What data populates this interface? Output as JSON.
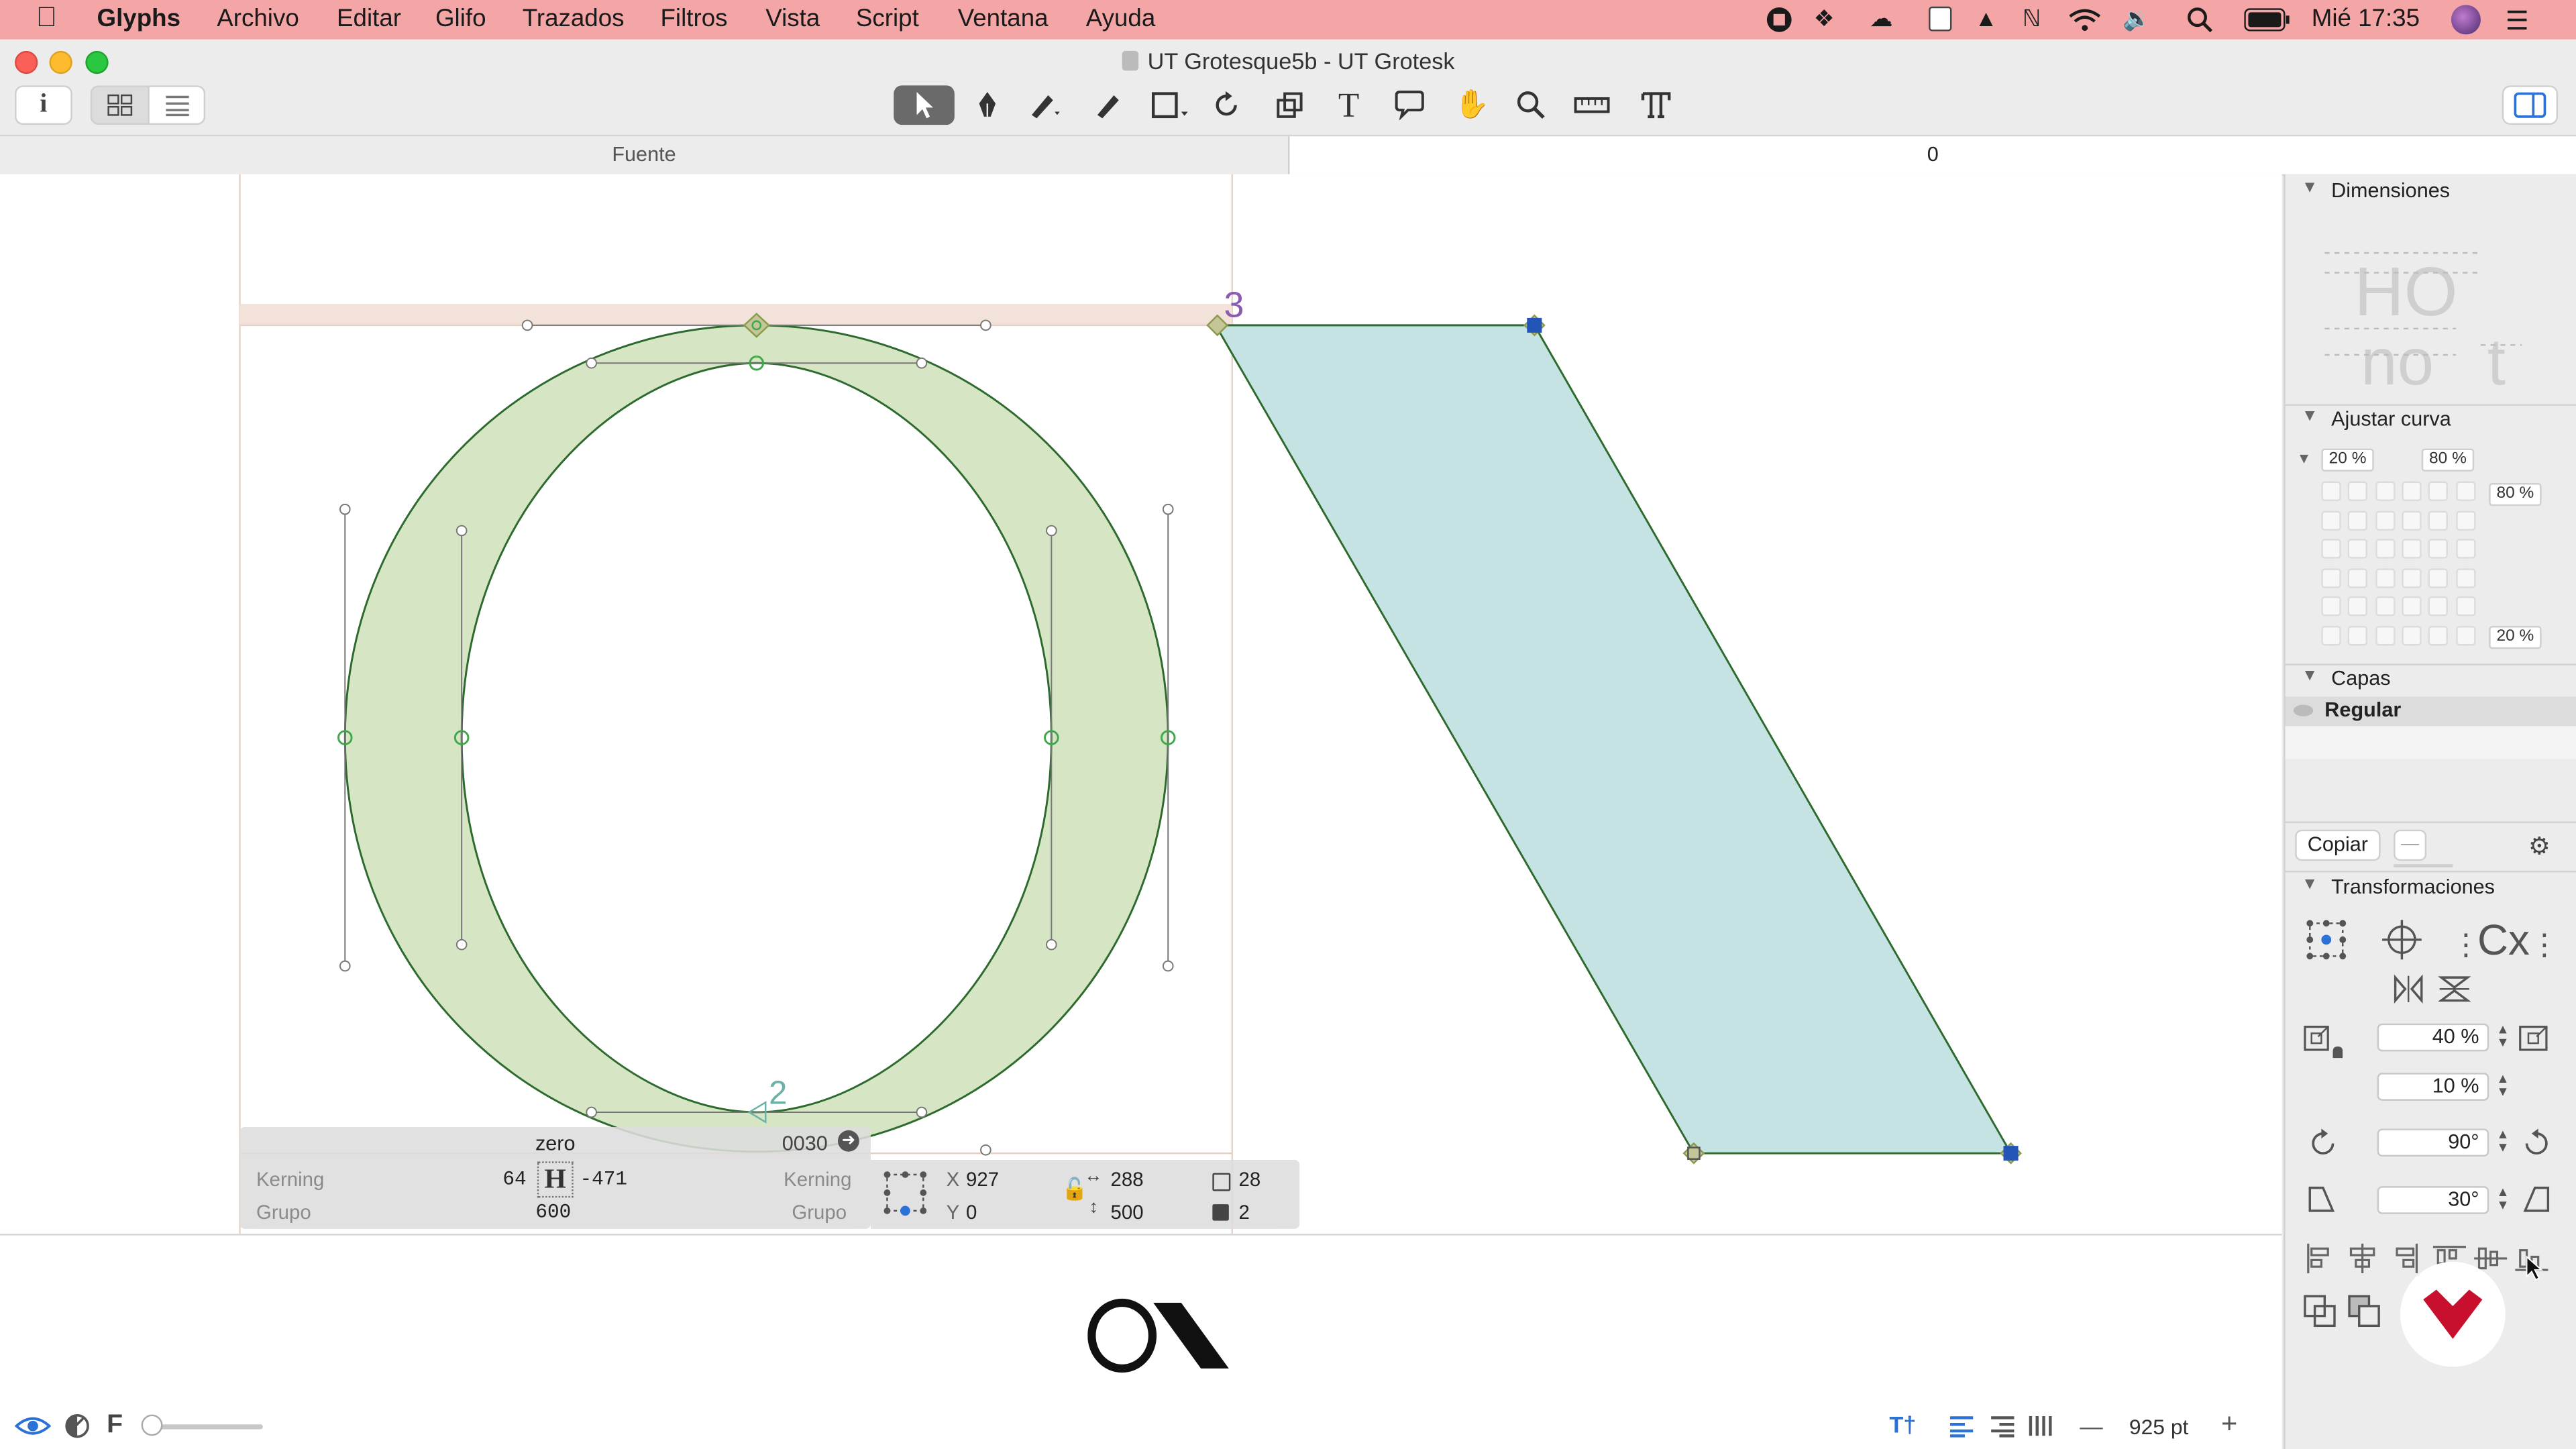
{
  "menubar": {
    "app": "Glyphs",
    "items": [
      "Archivo",
      "Editar",
      "Glifo",
      "Trazados",
      "Filtros",
      "Vista",
      "Script",
      "Ventana",
      "Ayuda"
    ],
    "clock": "Mié 17:35",
    "bg": "#f4a5a6"
  },
  "window": {
    "title": "UT Grotesque5b - UT Grotesk"
  },
  "tabs": {
    "left": "Fuente",
    "right": "0"
  },
  "info": {
    "glyph_name": "zero",
    "unicode": "0030",
    "kerning_label": "Kerning",
    "group_label": "Grupo",
    "lsb": "64",
    "rsb": "-471",
    "width": "600",
    "kerning_right_label": "Kerning",
    "group_right_label": "Grupo",
    "x_label": "X",
    "x_value": "927",
    "y_label": "Y",
    "y_value": "0",
    "w_value": "288",
    "h_value": "500",
    "nodes_value": "28",
    "paths_value": "2"
  },
  "canvas": {
    "marker_3": "3",
    "marker_2": "2",
    "preview_text": "O\\"
  },
  "sidebar": {
    "dimensions_title": "Dimensiones",
    "curve_title": "Ajustar curva",
    "curve_fields": [
      "20 %",
      "80 %",
      "80 %",
      "20 %"
    ],
    "layers_title": "Capas",
    "layer_name": "Regular",
    "copy_button": "Copiar",
    "minus_button": "—",
    "transform_title": "Transformaciones",
    "scale_x": "40 %",
    "scale_y": "10 %",
    "rotate": "90°",
    "slant": "30°",
    "hint_cx": "Cx"
  },
  "statusbar": {
    "font_letter": "F",
    "zoom": "925 pt",
    "minus": "—",
    "plus": "+"
  },
  "colors": {
    "glyph_fill_green": "#d6e5c4",
    "glyph_stroke": "#2d6a2d",
    "shape_fill_blue": "#c4e3e2",
    "node_blue": "#2355b8",
    "brand_red": "#c8102e"
  }
}
